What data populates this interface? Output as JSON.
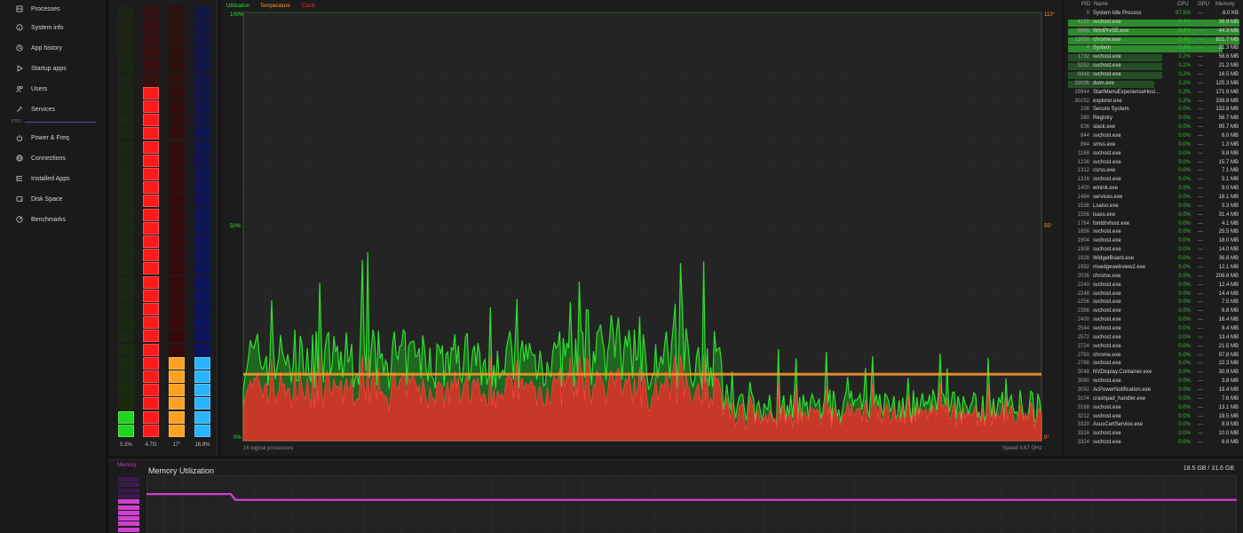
{
  "sidebar": {
    "items": [
      {
        "label": "Processes",
        "icon": "processes-icon"
      },
      {
        "label": "System info",
        "icon": "info-icon"
      },
      {
        "label": "App history",
        "icon": "history-icon"
      },
      {
        "label": "Startup apps",
        "icon": "play-icon"
      },
      {
        "label": "Users",
        "icon": "users-icon"
      },
      {
        "label": "Services",
        "icon": "wrench-icon"
      },
      {
        "label": "Power & Freq",
        "icon": "power-icon"
      },
      {
        "label": "Connections",
        "icon": "globe-icon"
      },
      {
        "label": "Installed Apps",
        "icon": "list-icon"
      },
      {
        "label": "Disk Space",
        "icon": "disk-icon"
      },
      {
        "label": "Benchmarks",
        "icon": "gauge-icon"
      }
    ],
    "section_label": "PRO"
  },
  "bars": [
    {
      "label": "5.3%",
      "value": 0.053,
      "color": "#1fd61f",
      "dim": "#1b2b10"
    },
    {
      "label": "4.7G",
      "value": 0.82,
      "color": "#ff1a1a",
      "dim": "#4a0a0a"
    },
    {
      "label": "17°",
      "value": 0.18,
      "color": "#ffa21f",
      "dim": "#3a0808"
    },
    {
      "label": "16.8%",
      "value": 0.18,
      "color": "#2ab4ff",
      "dim": "#0c1466"
    }
  ],
  "cpu": {
    "legend": {
      "utilization": "Utilization",
      "temperature": "Temperature",
      "clock": "Clock"
    },
    "axis_left": {
      "top": "100%",
      "mid": "50%",
      "bottom": "0%"
    },
    "axis_right": {
      "top": "110°",
      "mid": "55°",
      "bottom": "0°"
    },
    "footer_left": "16 logical processors",
    "footer_right": "Speed 4.67 GHz",
    "colors": {
      "utilization": "#2ee02e",
      "temperature": "#ff9a2a",
      "clock": "#ff2a2a",
      "grid": "#2a2a2a"
    }
  },
  "processes": {
    "headers": {
      "pid": "PID",
      "name": "Name",
      "cpu": "CPU",
      "gpu": "GPU",
      "memory": "Memory"
    },
    "rows": [
      {
        "pid": "0",
        "name": "System Idle Process",
        "cpu": "97.5%",
        "gpu": "—",
        "mem": "8.0 KB",
        "bar": 0
      },
      {
        "pid": "4120",
        "name": "svchost.exe",
        "cpu": "0.4%",
        "gpu": "—",
        "mem": "36.9 MB",
        "bar": 1
      },
      {
        "pid": "8996",
        "name": "WmiPrvSE.exe",
        "cpu": "0.4%",
        "gpu": "—",
        "mem": "44.3 MB",
        "bar": 1
      },
      {
        "pid": "12656",
        "name": "chrome.exe",
        "cpu": "0.4%",
        "gpu": "—",
        "mem": "821.7 MB",
        "bar": 1
      },
      {
        "pid": "4",
        "name": "System",
        "cpu": "0.3%",
        "gpu": "—",
        "mem": "21.3 MB",
        "bar": 0.9
      },
      {
        "pid": "1732",
        "name": "svchost.exe",
        "cpu": "0.2%",
        "gpu": "—",
        "mem": "58.6 MB",
        "bar": 0.55
      },
      {
        "pid": "5252",
        "name": "svchost.exe",
        "cpu": "0.2%",
        "gpu": "—",
        "mem": "21.2 MB",
        "bar": 0.55
      },
      {
        "pid": "6848",
        "name": "svchost.exe",
        "cpu": "0.2%",
        "gpu": "—",
        "mem": "18.5 MB",
        "bar": 0.55
      },
      {
        "pid": "28096",
        "name": "dwm.exe",
        "cpu": "0.2%",
        "gpu": "—",
        "mem": "125.3 MB",
        "bar": 0.5
      },
      {
        "pid": "29944",
        "name": "StartMenuExperienceHost...",
        "cpu": "0.2%",
        "gpu": "—",
        "mem": "171.9 MB",
        "bar": 0
      },
      {
        "pid": "30152",
        "name": "explorer.exe",
        "cpu": "0.2%",
        "gpu": "—",
        "mem": "338.8 MB",
        "bar": 0
      },
      {
        "pid": "236",
        "name": "Secure System",
        "cpu": "0.0%",
        "gpu": "—",
        "mem": "132.8 MB",
        "bar": 0
      },
      {
        "pid": "280",
        "name": "Registry",
        "cpu": "0.0%",
        "gpu": "—",
        "mem": "56.7 MB",
        "bar": 0
      },
      {
        "pid": "836",
        "name": "slack.exe",
        "cpu": "0.0%",
        "gpu": "—",
        "mem": "95.7 MB",
        "bar": 0
      },
      {
        "pid": "844",
        "name": "svchost.exe",
        "cpu": "0.0%",
        "gpu": "—",
        "mem": "6.0 MB",
        "bar": 0
      },
      {
        "pid": "864",
        "name": "smss.exe",
        "cpu": "0.0%",
        "gpu": "—",
        "mem": "1.3 MB",
        "bar": 0
      },
      {
        "pid": "1168",
        "name": "svchost.exe",
        "cpu": "0.0%",
        "gpu": "—",
        "mem": "9.8 MB",
        "bar": 0
      },
      {
        "pid": "1236",
        "name": "svchost.exe",
        "cpu": "0.0%",
        "gpu": "—",
        "mem": "15.7 MB",
        "bar": 0
      },
      {
        "pid": "1312",
        "name": "csrss.exe",
        "cpu": "0.0%",
        "gpu": "—",
        "mem": "7.1 MB",
        "bar": 0
      },
      {
        "pid": "1316",
        "name": "svchost.exe",
        "cpu": "0.0%",
        "gpu": "—",
        "mem": "5.1 MB",
        "bar": 0
      },
      {
        "pid": "1400",
        "name": "wininit.exe",
        "cpu": "0.0%",
        "gpu": "—",
        "mem": "9.0 MB",
        "bar": 0
      },
      {
        "pid": "1484",
        "name": "services.exe",
        "cpu": "0.0%",
        "gpu": "—",
        "mem": "18.1 MB",
        "bar": 0
      },
      {
        "pid": "1536",
        "name": "Lsaiso.exe",
        "cpu": "0.0%",
        "gpu": "—",
        "mem": "3.3 MB",
        "bar": 0
      },
      {
        "pid": "1556",
        "name": "lsass.exe",
        "cpu": "0.0%",
        "gpu": "—",
        "mem": "31.4 MB",
        "bar": 0
      },
      {
        "pid": "1764",
        "name": "fontdrvhost.exe",
        "cpu": "0.0%",
        "gpu": "—",
        "mem": "4.1 MB",
        "bar": 0
      },
      {
        "pid": "1856",
        "name": "svchost.exe",
        "cpu": "0.0%",
        "gpu": "—",
        "mem": "25.5 MB",
        "bar": 0
      },
      {
        "pid": "1904",
        "name": "svchost.exe",
        "cpu": "0.0%",
        "gpu": "—",
        "mem": "18.0 MB",
        "bar": 0
      },
      {
        "pid": "1908",
        "name": "svchost.exe",
        "cpu": "0.0%",
        "gpu": "—",
        "mem": "14.0 MB",
        "bar": 0
      },
      {
        "pid": "1928",
        "name": "WidgetBoard.exe",
        "cpu": "0.0%",
        "gpu": "—",
        "mem": "36.8 MB",
        "bar": 0
      },
      {
        "pid": "1992",
        "name": "msedgewebview2.exe",
        "cpu": "0.0%",
        "gpu": "—",
        "mem": "12.1 MB",
        "bar": 0
      },
      {
        "pid": "2036",
        "name": "chrome.exe",
        "cpu": "0.0%",
        "gpu": "—",
        "mem": "208.6 MB",
        "bar": 0
      },
      {
        "pid": "2240",
        "name": "svchost.exe",
        "cpu": "0.0%",
        "gpu": "—",
        "mem": "12.4 MB",
        "bar": 0
      },
      {
        "pid": "2248",
        "name": "svchost.exe",
        "cpu": "0.0%",
        "gpu": "—",
        "mem": "14.4 MB",
        "bar": 0
      },
      {
        "pid": "2256",
        "name": "svchost.exe",
        "cpu": "0.0%",
        "gpu": "—",
        "mem": "7.5 MB",
        "bar": 0
      },
      {
        "pid": "2388",
        "name": "svchost.exe",
        "cpu": "0.0%",
        "gpu": "—",
        "mem": "6.8 MB",
        "bar": 0
      },
      {
        "pid": "2400",
        "name": "svchost.exe",
        "cpu": "0.0%",
        "gpu": "—",
        "mem": "16.4 MB",
        "bar": 0
      },
      {
        "pid": "2544",
        "name": "svchost.exe",
        "cpu": "0.0%",
        "gpu": "—",
        "mem": "8.4 MB",
        "bar": 0
      },
      {
        "pid": "2572",
        "name": "svchost.exe",
        "cpu": "0.0%",
        "gpu": "—",
        "mem": "13.4 MB",
        "bar": 0
      },
      {
        "pid": "2724",
        "name": "svchost.exe",
        "cpu": "0.0%",
        "gpu": "—",
        "mem": "21.5 MB",
        "bar": 0
      },
      {
        "pid": "2760",
        "name": "chrome.exe",
        "cpu": "0.0%",
        "gpu": "—",
        "mem": "97.8 MB",
        "bar": 0
      },
      {
        "pid": "2768",
        "name": "svchost.exe",
        "cpu": "0.0%",
        "gpu": "—",
        "mem": "22.3 MB",
        "bar": 0
      },
      {
        "pid": "3048",
        "name": "NVDisplay.Container.exe",
        "cpu": "0.0%",
        "gpu": "—",
        "mem": "30.9 MB",
        "bar": 0
      },
      {
        "pid": "3080",
        "name": "svchost.exe",
        "cpu": "0.0%",
        "gpu": "—",
        "mem": "3.8 MB",
        "bar": 0
      },
      {
        "pid": "3092",
        "name": "AcPowerNotification.exe",
        "cpu": "0.0%",
        "gpu": "—",
        "mem": "19.4 MB",
        "bar": 0
      },
      {
        "pid": "3104",
        "name": "crashpad_handler.exe",
        "cpu": "0.0%",
        "gpu": "—",
        "mem": "7.6 MB",
        "bar": 0
      },
      {
        "pid": "3168",
        "name": "svchost.exe",
        "cpu": "0.0%",
        "gpu": "—",
        "mem": "13.1 MB",
        "bar": 0
      },
      {
        "pid": "3212",
        "name": "svchost.exe",
        "cpu": "0.0%",
        "gpu": "—",
        "mem": "19.5 MB",
        "bar": 0
      },
      {
        "pid": "3320",
        "name": "AsusCertService.exe",
        "cpu": "0.0%",
        "gpu": "—",
        "mem": "8.9 MB",
        "bar": 0
      },
      {
        "pid": "3316",
        "name": "svchost.exe",
        "cpu": "0.0%",
        "gpu": "—",
        "mem": "10.0 MB",
        "bar": 0
      },
      {
        "pid": "3324",
        "name": "svchost.exe",
        "cpu": "0.0%",
        "gpu": "—",
        "mem": "6.6 MB",
        "bar": 0
      }
    ]
  },
  "memory": {
    "label": "Memory",
    "title": "Memory Utilization",
    "value": "18.5 GB / 31.6 GB",
    "used_fraction": 0.585,
    "color": "#d040d0"
  }
}
